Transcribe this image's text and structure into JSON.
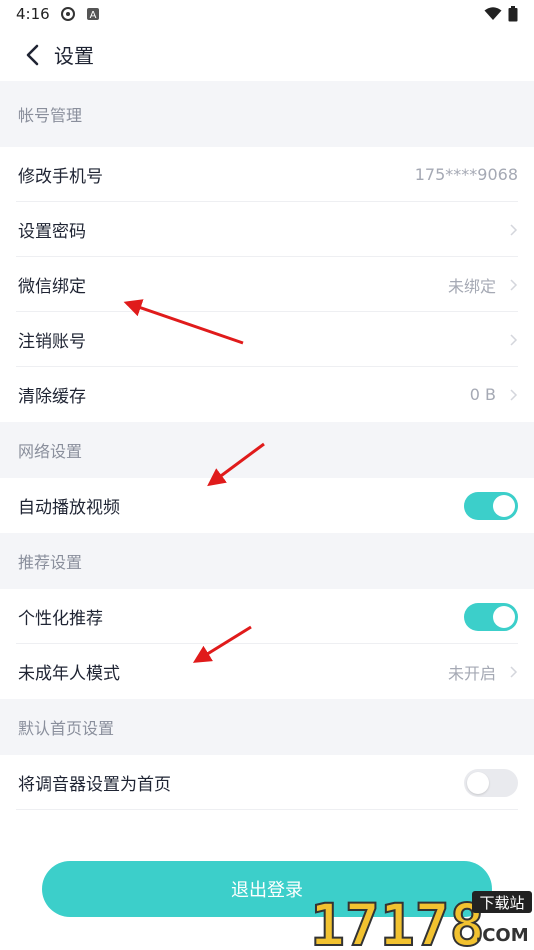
{
  "status_bar": {
    "time": "4:16"
  },
  "nav": {
    "title": "设置"
  },
  "sections": {
    "account": {
      "header": "帐号管理",
      "change_phone": {
        "label": "修改手机号",
        "value": "175****9068"
      },
      "set_password": {
        "label": "设置密码"
      },
      "wechat_bind": {
        "label": "微信绑定",
        "value": "未绑定"
      },
      "cancel_account": {
        "label": "注销账号"
      },
      "clear_cache": {
        "label": "清除缓存",
        "value": "0 B"
      }
    },
    "network": {
      "header": "网络设置",
      "autoplay_video": {
        "label": "自动播放视频",
        "enabled": true
      }
    },
    "recommend": {
      "header": "推荐设置",
      "personalized": {
        "label": "个性化推荐",
        "enabled": true
      },
      "minor_mode": {
        "label": "未成年人模式",
        "value": "未开启"
      }
    },
    "homepage": {
      "header": "默认首页设置",
      "tuner_as_home": {
        "label": "将调音器设置为首页",
        "enabled": false
      }
    }
  },
  "logout_button": {
    "label": "退出登录"
  },
  "watermark": {
    "text": "17178",
    "badge": "下载站",
    "suffix": ".COM"
  },
  "colors": {
    "accent": "#3ccfca",
    "arrow": "#e01b1b",
    "section_bg": "#f4f5f8"
  }
}
